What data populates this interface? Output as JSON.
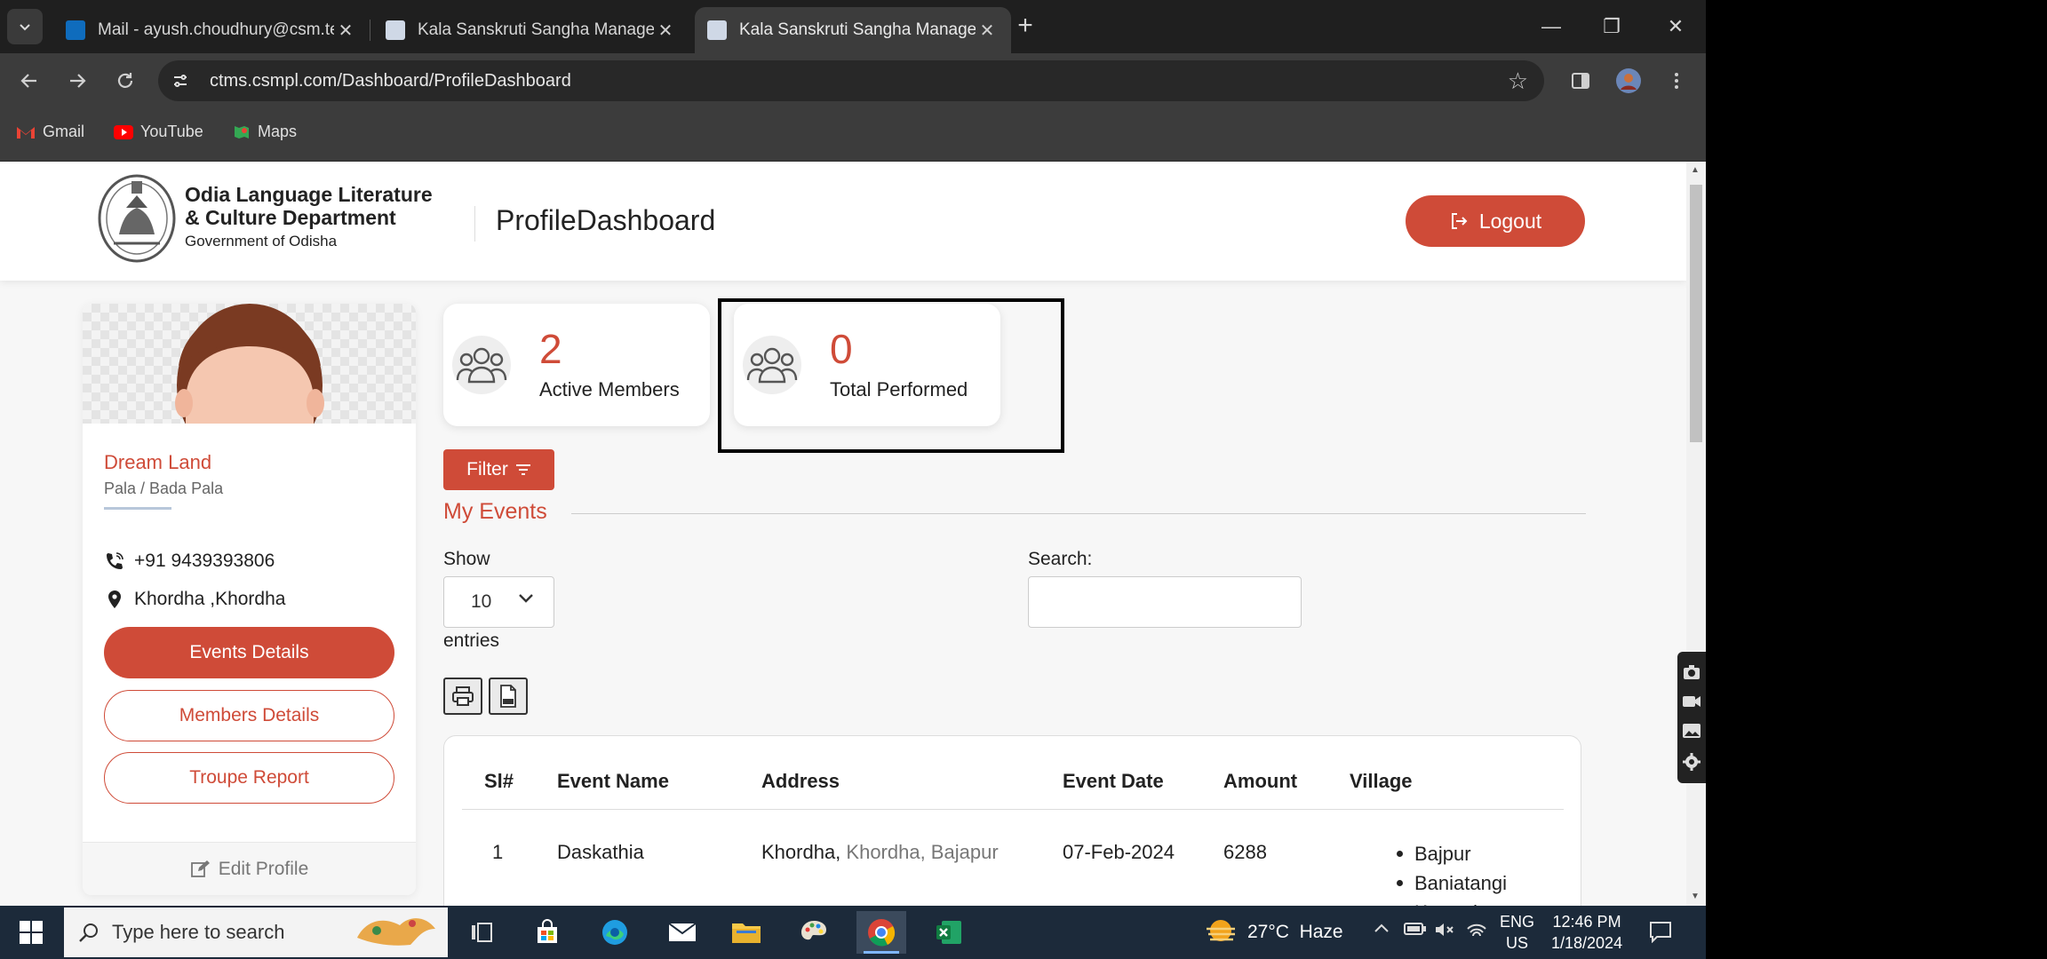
{
  "browser": {
    "tabs": [
      {
        "title": "Mail - ayush.choudhury@csm.tech",
        "active": false
      },
      {
        "title": "Kala Sanskruti Sangha Management",
        "active": false
      },
      {
        "title": "Kala Sanskruti Sangha Management",
        "active": true
      }
    ],
    "url": "ctms.csmpl.com/Dashboard/ProfileDashboard",
    "bookmarks": [
      "Gmail",
      "YouTube",
      "Maps"
    ]
  },
  "header": {
    "dept_line1": "Odia Language Literature",
    "dept_line2": "& Culture Department",
    "dept_line3": "Government of Odisha",
    "page_title": "ProfileDashboard",
    "logout_label": "Logout"
  },
  "profile": {
    "name": "Dream Land",
    "category": "Pala / Bada Pala",
    "phone": "+91 9439393806",
    "location": "Khordha ,Khordha",
    "buttons": [
      "Events Details",
      "Members Details",
      "Troupe Report"
    ],
    "edit_label": "Edit Profile"
  },
  "stats": [
    {
      "value": "2",
      "label": "Active Members"
    },
    {
      "value": "0",
      "label": "Total Performed"
    }
  ],
  "events": {
    "filter_label": "Filter",
    "section_title": "My Events",
    "show_label": "Show",
    "page_size": "10",
    "entries_label": "entries",
    "search_label": "Search:",
    "search_value": "",
    "columns": [
      "Sl#",
      "Event Name",
      "Address",
      "Event Date",
      "Amount",
      "Village"
    ],
    "rows": [
      {
        "sl": "1",
        "event_name": "Daskathia",
        "address_main": "Khordha,",
        "address_detail": " Khordha, Bajapur",
        "event_date": "07-Feb-2024",
        "amount": "6288",
        "villages": [
          "Bajpur",
          "Baniatangi",
          "Koranda"
        ]
      }
    ]
  },
  "taskbar": {
    "search_placeholder": "Type here to search",
    "weather": "27°C  Haze",
    "lang_line1": "ENG",
    "lang_line2": "US",
    "time": "12:46 PM",
    "date": "1/18/2024"
  },
  "colors": {
    "accent": "#cf4b38",
    "tabstrip": "#1f1f1f",
    "toolbar": "#3c3c3c",
    "taskbar": "#1c2a3a"
  }
}
